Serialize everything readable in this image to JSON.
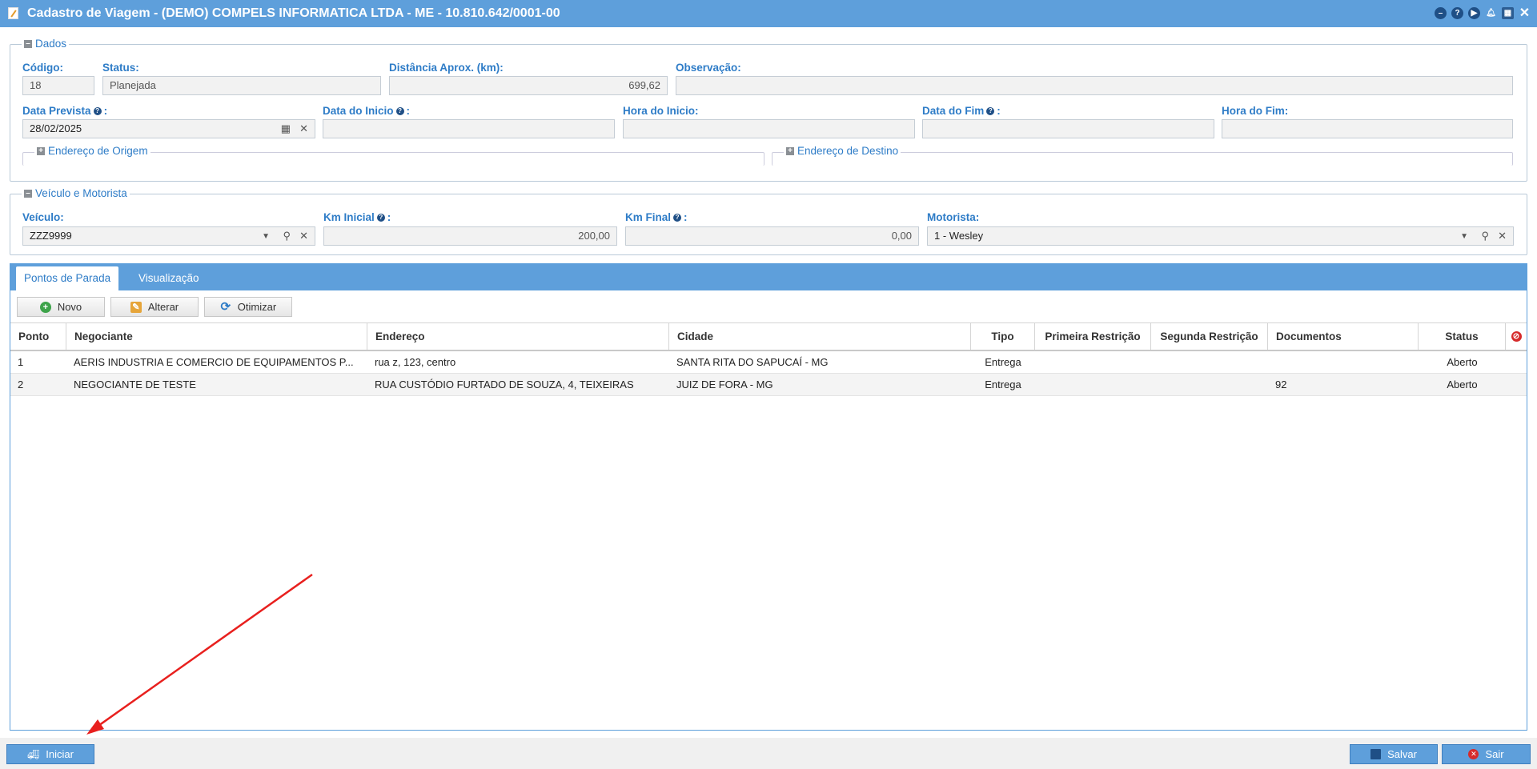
{
  "window": {
    "title": "Cadastro de Viagem - (DEMO) COMPELS INFORMATICA LTDA - ME - 10.810.642/0001-00"
  },
  "dados": {
    "legend": "Dados",
    "codigo": {
      "label": "Código:",
      "value": "18"
    },
    "status": {
      "label": "Status:",
      "value": "Planejada"
    },
    "distancia": {
      "label": "Distância Aprox. (km):",
      "value": "699,62"
    },
    "observacao": {
      "label": "Observação:",
      "value": ""
    },
    "data_prevista": {
      "label": "Data Prevista",
      "value": "28/02/2025"
    },
    "data_inicio": {
      "label": "Data do Inicio",
      "value": ""
    },
    "hora_inicio": {
      "label": "Hora do Inicio:",
      "value": ""
    },
    "data_fim": {
      "label": "Data do Fim",
      "value": ""
    },
    "hora_fim": {
      "label": "Hora do Fim:",
      "value": ""
    },
    "endereco_origem": "Endereço de Origem",
    "endereco_destino": "Endereço de Destino"
  },
  "veiculo_motorista": {
    "legend": "Veículo e Motorista",
    "veiculo": {
      "label": "Veículo:",
      "value": "ZZZ9999"
    },
    "km_inicial": {
      "label": "Km Inicial",
      "value": "200,00"
    },
    "km_final": {
      "label": "Km Final",
      "value": "0,00"
    },
    "motorista": {
      "label": "Motorista:",
      "value": "1 - Wesley"
    }
  },
  "tabs": [
    "Pontos de Parada",
    "Visualização"
  ],
  "toolbar": {
    "novo": "Novo",
    "alterar": "Alterar",
    "otimizar": "Otimizar"
  },
  "grid": {
    "columns": [
      "Ponto",
      "Negociante",
      "Endereço",
      "Cidade",
      "Tipo",
      "Primeira Restrição",
      "Segunda Restrição",
      "Documentos",
      "Status"
    ],
    "rows": [
      [
        "1",
        "AERIS INDUSTRIA E COMERCIO DE EQUIPAMENTOS P...",
        "rua z, 123, centro",
        "SANTA RITA DO SAPUCAÍ - MG",
        "Entrega",
        "",
        "",
        "",
        "Aberto"
      ],
      [
        "2",
        "NEGOCIANTE DE TESTE",
        "RUA CUSTÓDIO FURTADO DE SOUZA, 4, TEIXEIRAS",
        "JUIZ DE FORA - MG",
        "Entrega",
        "",
        "",
        "92",
        "Aberto"
      ]
    ]
  },
  "footer": {
    "iniciar": "Iniciar",
    "salvar": "Salvar",
    "sair": "Sair"
  },
  "colors": {
    "accent": "#5e9fdb",
    "label": "#2e7cc7",
    "annotation_arrow": "#e8201e"
  }
}
